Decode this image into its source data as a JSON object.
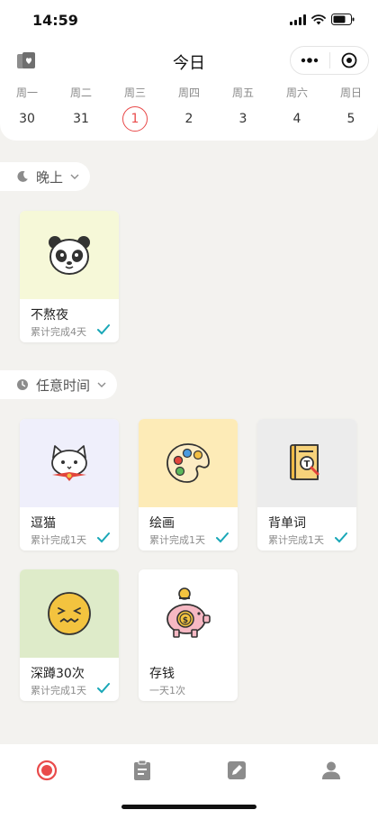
{
  "status_bar": {
    "time": "14:59"
  },
  "header": {
    "title": "今日",
    "week": [
      {
        "label": "周一",
        "date": "30",
        "active": false
      },
      {
        "label": "周二",
        "date": "31",
        "active": false
      },
      {
        "label": "周三",
        "date": "1",
        "active": true
      },
      {
        "label": "周四",
        "date": "2",
        "active": false
      },
      {
        "label": "周五",
        "date": "3",
        "active": false
      },
      {
        "label": "周六",
        "date": "4",
        "active": false
      },
      {
        "label": "周日",
        "date": "5",
        "active": false
      }
    ]
  },
  "sections": {
    "evening": {
      "label": "晚上"
    },
    "anytime": {
      "label": "任意时间"
    }
  },
  "habits": {
    "evening": [
      {
        "name": "不熬夜",
        "sub": "累计完成4天",
        "done": true,
        "icon": "panda-icon",
        "bg": "#f6f8d8"
      }
    ],
    "anytime": [
      {
        "name": "逗猫",
        "sub": "累计完成1天",
        "done": true,
        "icon": "cat-icon",
        "bg": "#efeffb"
      },
      {
        "name": "绘画",
        "sub": "累计完成1天",
        "done": true,
        "icon": "palette-icon",
        "bg": "#fdebb7"
      },
      {
        "name": "背单词",
        "sub": "累计完成1天",
        "done": true,
        "icon": "book-icon",
        "bg": "#ececec"
      },
      {
        "name": "深蹲30次",
        "sub": "累计完成1天",
        "done": true,
        "icon": "tired-face-icon",
        "bg": "#deebc9"
      },
      {
        "name": "存钱",
        "sub": "一天1次",
        "done": false,
        "icon": "piggy-bank-icon",
        "bg": "#ffffff"
      }
    ]
  },
  "colors": {
    "accent": "#e94b4b",
    "check": "#19a7b7"
  },
  "nav": [
    "today-icon",
    "clipboard-icon",
    "edit-icon",
    "profile-icon"
  ]
}
